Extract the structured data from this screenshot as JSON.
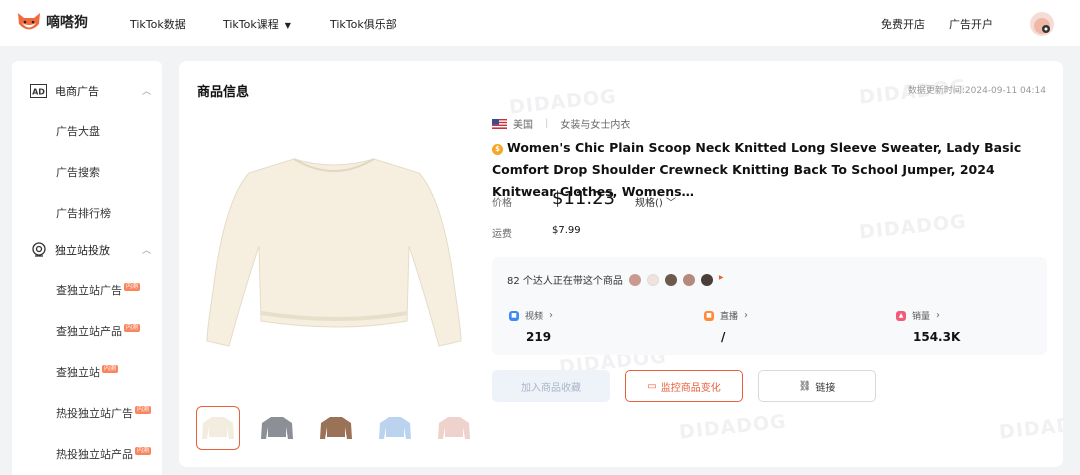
{
  "app": {
    "name": "嘀嗒狗"
  },
  "topnav": {
    "items": [
      "TikTok数据",
      "TikTok课程",
      "TikTok俱乐部"
    ],
    "right": [
      "免费开店",
      "广告开户"
    ]
  },
  "sidebar": {
    "group1": {
      "label": "电商广告",
      "items": [
        "广告大盘",
        "广告搜索",
        "广告排行榜"
      ]
    },
    "group2": {
      "label": "独立站投放",
      "items": [
        "查独立站广告",
        "查独立站产品",
        "查独立站",
        "热投独立站广告",
        "热投独立站产品"
      ],
      "new_tag": "内测"
    }
  },
  "main": {
    "section_title": "商品信息",
    "update_time": "数据更新时间:2024-09-11 04:14",
    "watermark": "DIDADOG",
    "country": "美国",
    "category": "女装与女士内衣",
    "title": "Women's Chic Plain Scoop Neck Knitted Long Sleeve Sweater, Lady Basic Comfort Drop Shoulder Crewneck Knitting Back To School Jumper, 2024 Knitwear Clothes, Womens…",
    "price_label": "价格",
    "price": "$11.23",
    "spec_label": "规格()",
    "shipping_label": "运费",
    "shipping": "$7.99",
    "influencers_text": "82 个达人正在带这个商品",
    "stats": [
      {
        "label": "视频",
        "value": "219",
        "color": "#3d8bf2"
      },
      {
        "label": "直播",
        "value": "/",
        "color": "#ff8a3d"
      },
      {
        "label": "销量",
        "value": "154.3K",
        "color": "#f25a7a"
      }
    ],
    "buttons": {
      "favorite": "加入商品收藏",
      "monitor": "监控商品变化",
      "link": "链接"
    },
    "thumb_colors": [
      "#f3ede0",
      "#8c8f96",
      "#9a7257",
      "#bcd3f0",
      "#eed2cc"
    ]
  },
  "colors": {
    "accent": "#e8613c",
    "bg": "#f2f3f5"
  }
}
